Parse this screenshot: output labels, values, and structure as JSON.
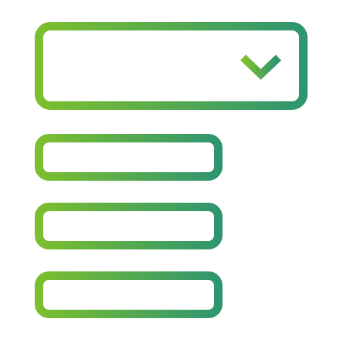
{
  "icon": {
    "name": "dropdown-list-icon",
    "gradient_start": "#7CBF2E",
    "gradient_end": "#2F9570",
    "background": "#FFFFFF"
  },
  "dropdown": {
    "icon": "chevron-down-icon",
    "option_count": 3
  }
}
